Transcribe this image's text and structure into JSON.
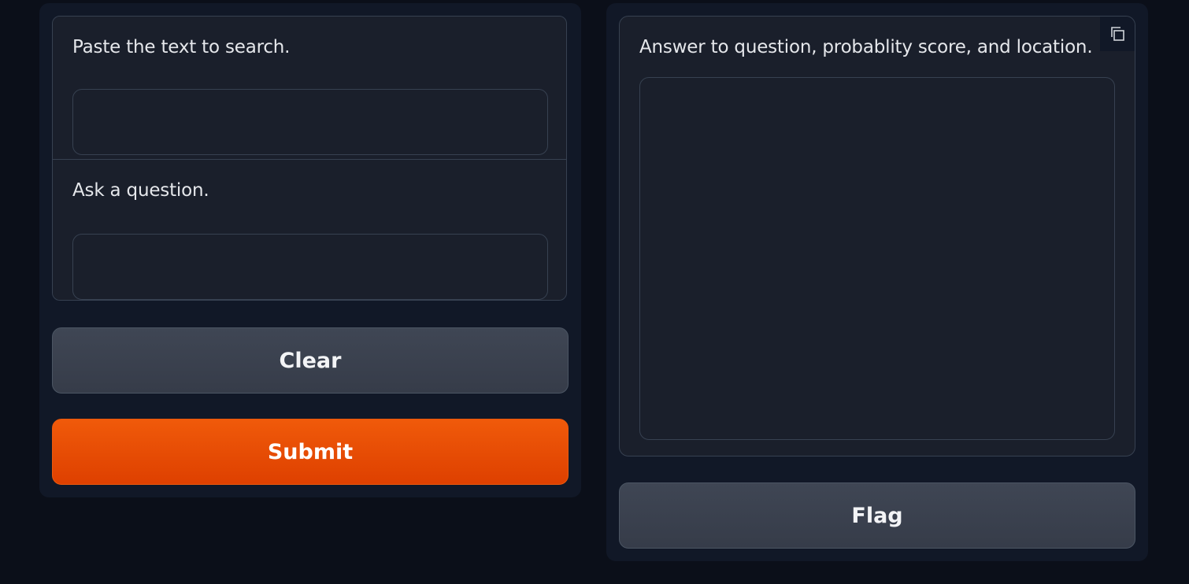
{
  "inputs": {
    "context": {
      "label": "Paste the text to search.",
      "value": "",
      "placeholder": ""
    },
    "question": {
      "label": "Ask a question.",
      "value": "",
      "placeholder": ""
    }
  },
  "actions": {
    "clear_label": "Clear",
    "submit_label": "Submit"
  },
  "output": {
    "label": "Answer to question, probablity score, and location.",
    "value": "",
    "copy_icon": "copy-icon",
    "flag_label": "Flag"
  },
  "colors": {
    "background": "#0b0f19",
    "panel": "#111827",
    "primary": "#ea580c",
    "secondary": "#374151"
  }
}
